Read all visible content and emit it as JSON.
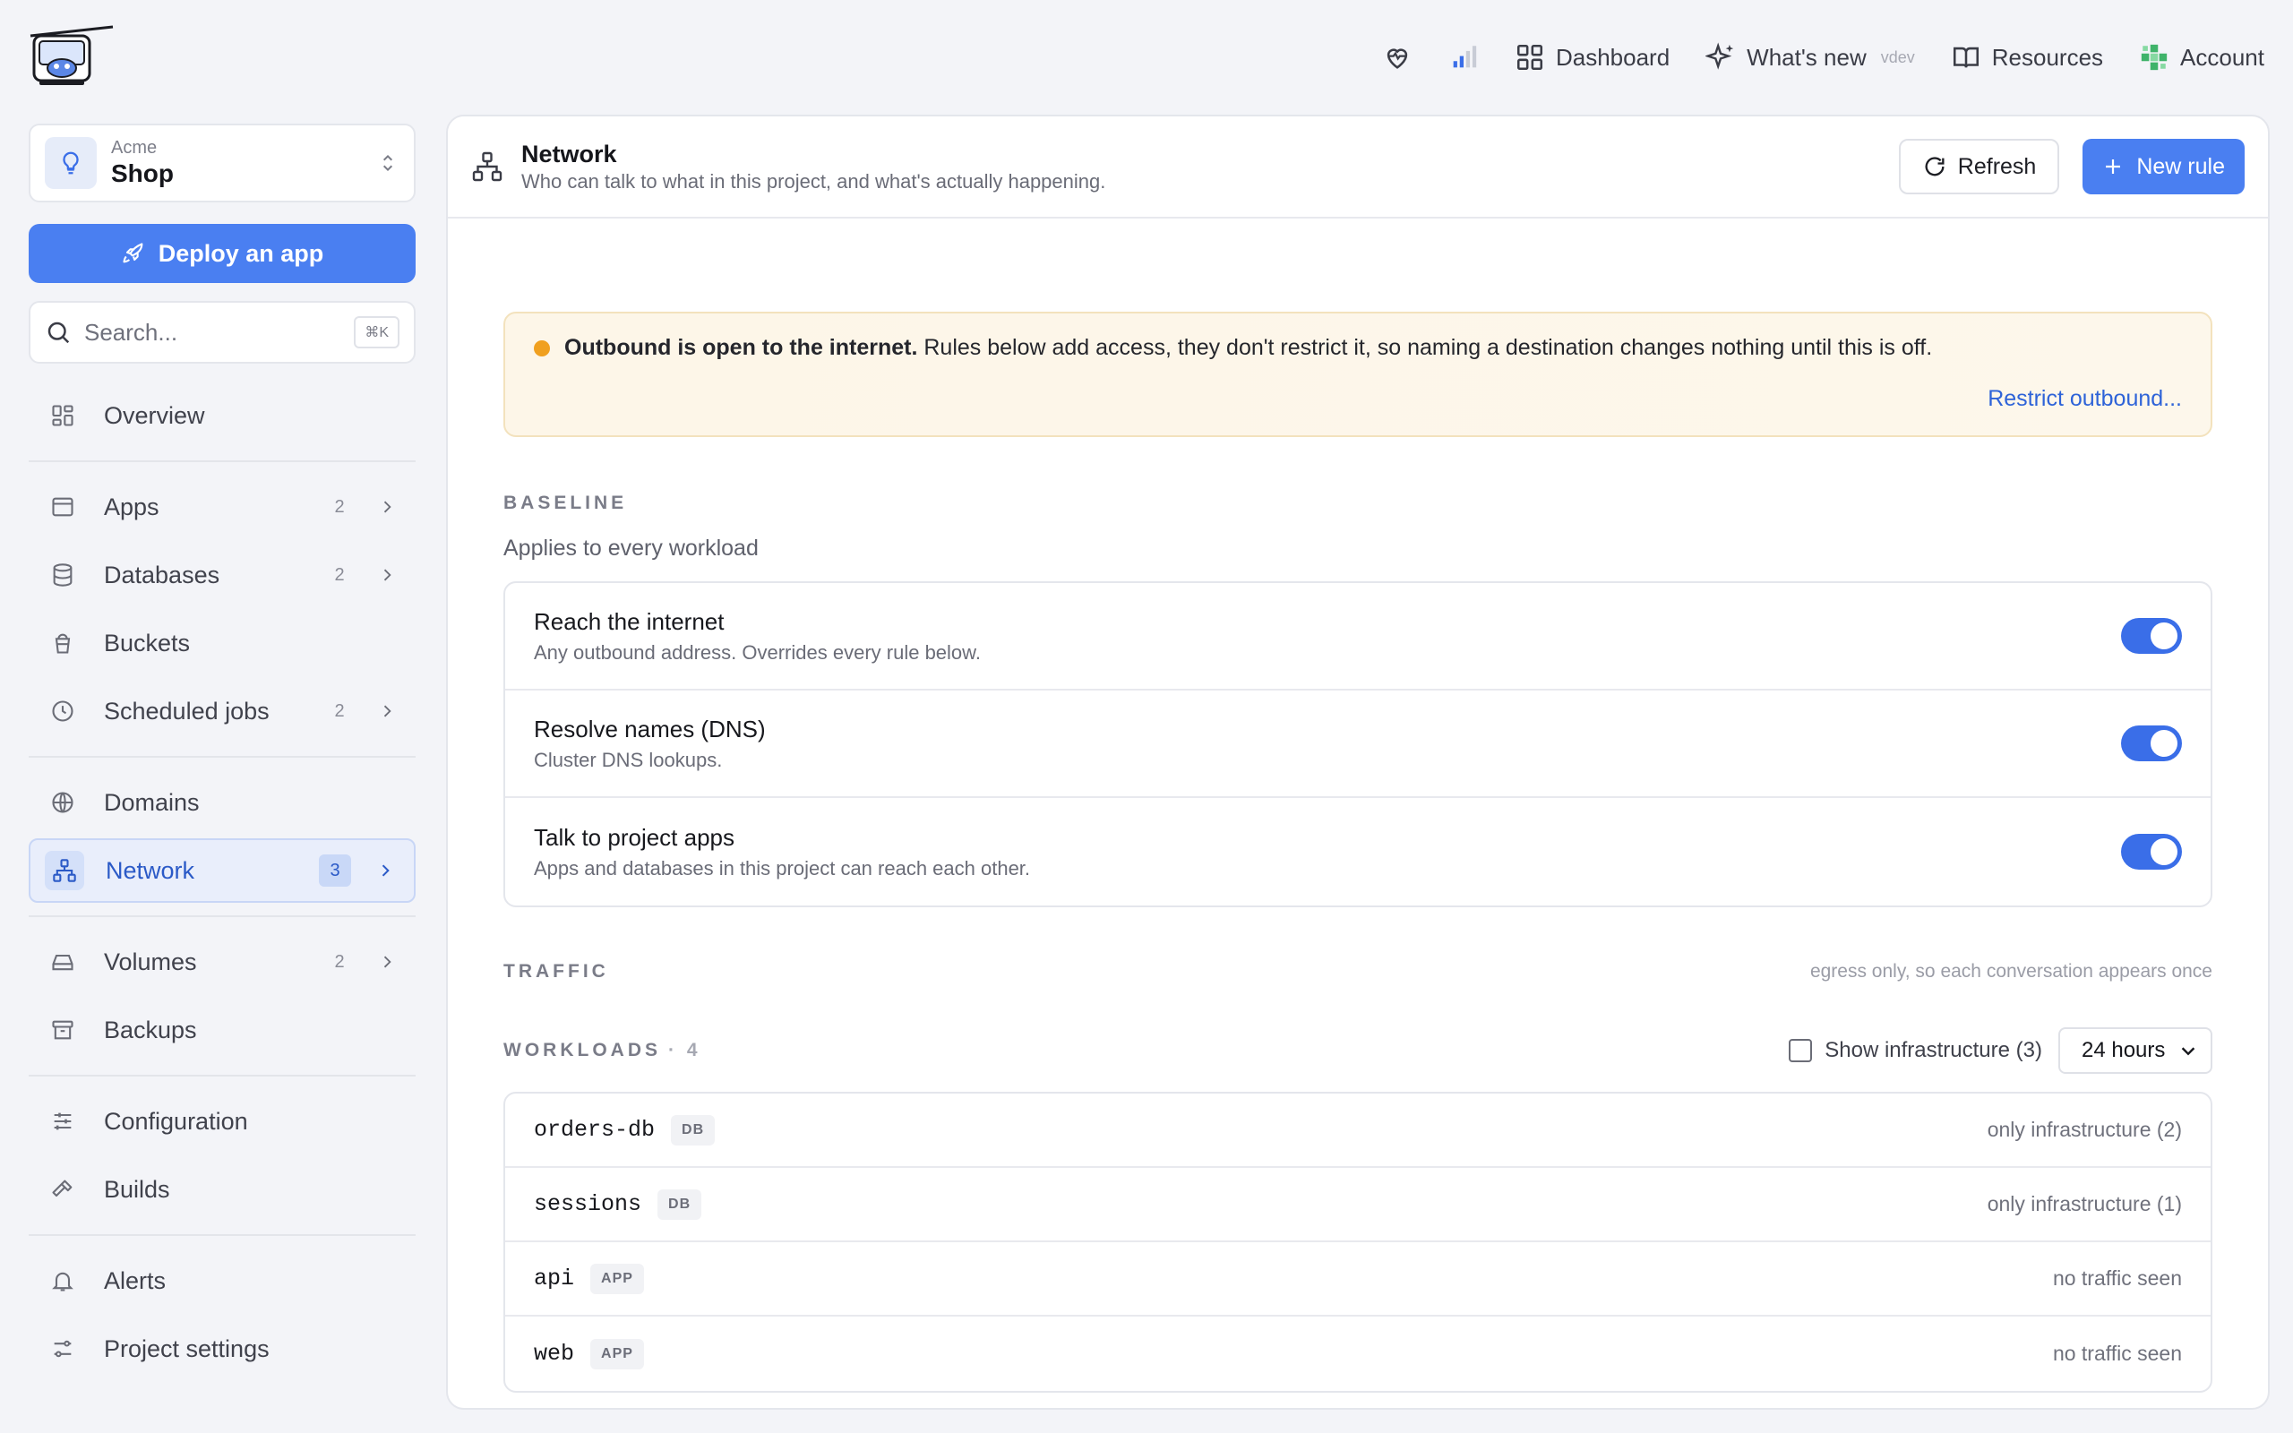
{
  "topnav": {
    "dashboard": "Dashboard",
    "whats_new": "What's new",
    "version": "vdev",
    "resources": "Resources",
    "account": "Account"
  },
  "sidebar": {
    "project": {
      "org": "Acme",
      "name": "Shop"
    },
    "deploy_label": "Deploy an app",
    "search": {
      "placeholder": "Search...",
      "shortcut": "⌘K"
    },
    "items": [
      {
        "label": "Overview",
        "icon": "grid-icon"
      },
      {
        "label": "Apps",
        "count": "2",
        "icon": "window-icon"
      },
      {
        "label": "Databases",
        "count": "2",
        "icon": "database-icon"
      },
      {
        "label": "Buckets",
        "icon": "bucket-icon"
      },
      {
        "label": "Scheduled jobs",
        "count": "2",
        "icon": "clock-icon"
      },
      {
        "label": "Domains",
        "icon": "globe-icon"
      },
      {
        "label": "Network",
        "count": "3",
        "icon": "network-icon"
      },
      {
        "label": "Volumes",
        "count": "2",
        "icon": "drive-icon"
      },
      {
        "label": "Backups",
        "icon": "archive-icon"
      },
      {
        "label": "Configuration",
        "icon": "sliders-icon"
      },
      {
        "label": "Builds",
        "icon": "hammer-icon"
      },
      {
        "label": "Alerts",
        "icon": "bell-icon"
      },
      {
        "label": "Project settings",
        "icon": "settings-icon"
      }
    ]
  },
  "page": {
    "title": "Network",
    "subtitle": "Who can talk to what in this project, and what's actually happening.",
    "refresh_label": "Refresh",
    "new_rule_label": "New rule"
  },
  "warning": {
    "bold": "Outbound is open to the internet.",
    "text": " Rules below add access, they don't restrict it, so naming a destination changes nothing until this is off.",
    "link": "Restrict outbound..."
  },
  "baseline": {
    "label": "BASELINE",
    "subtitle": "Applies to every workload",
    "rows": [
      {
        "title": "Reach the internet",
        "desc": "Any outbound address. Overrides every rule below.",
        "on": true
      },
      {
        "title": "Resolve names (DNS)",
        "desc": "Cluster DNS lookups.",
        "on": true
      },
      {
        "title": "Talk to project apps",
        "desc": "Apps and databases in this project can reach each other.",
        "on": true
      }
    ]
  },
  "traffic": {
    "label": "TRAFFIC",
    "note": "egress only, so each conversation appears once"
  },
  "workloads": {
    "label": "WORKLOADS",
    "count": "· 4",
    "show_infra_label": "Show infrastructure (3)",
    "range": "24 hours",
    "rows": [
      {
        "name": "orders-db",
        "tag": "DB",
        "status": "only infrastructure (2)"
      },
      {
        "name": "sessions",
        "tag": "DB",
        "status": "only infrastructure (1)"
      },
      {
        "name": "api",
        "tag": "APP",
        "status": "no traffic seen"
      },
      {
        "name": "web",
        "tag": "APP",
        "status": "no traffic seen"
      }
    ]
  },
  "colors": {
    "accent": "#4a7ff1",
    "warning_dot": "#f0a01f",
    "active_nav": "#2b5ac7"
  }
}
